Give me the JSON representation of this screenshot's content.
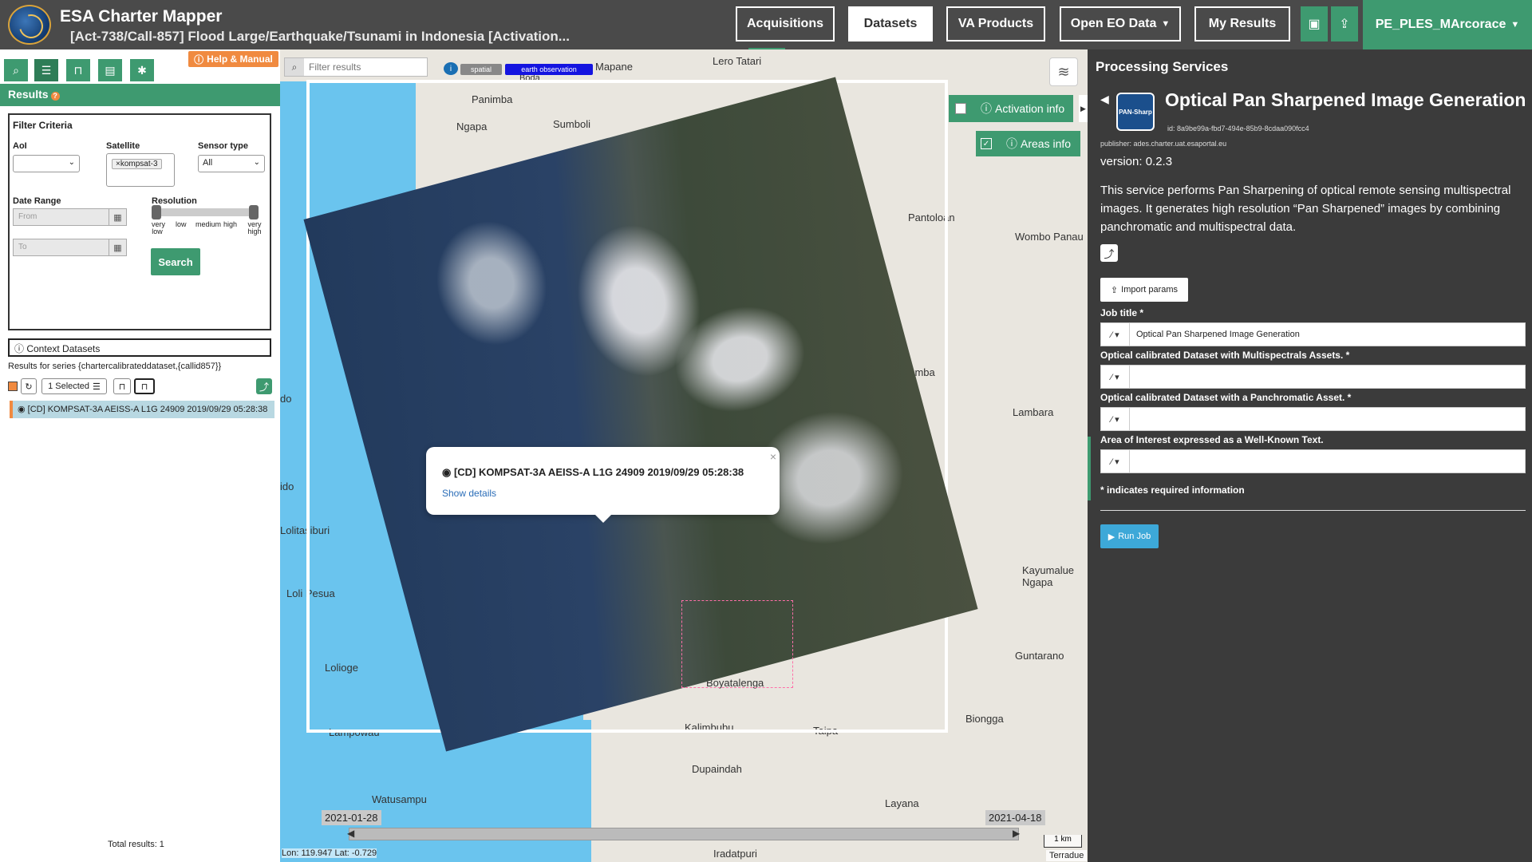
{
  "header": {
    "app_title": "ESA Charter Mapper",
    "activation": "[Act-738/Call-857] Flood Large/Earthquake/Tsunami in Indonesia [Activation...",
    "nav": [
      "Acquisitions",
      "Datasets",
      "VA Products",
      "Open EO Data",
      "My Results"
    ],
    "active_nav": "Datasets",
    "user": "PE_PLES_MArcorace"
  },
  "left": {
    "help": "Help & Manual",
    "results_title": "Results",
    "filter_title": "Filter Criteria",
    "aoi_label": "AoI",
    "satellite_label": "Satellite",
    "satellite_tag": "kompsat-3",
    "sensor_label": "Sensor type",
    "sensor_value": "All",
    "date_label": "Date Range",
    "from_placeholder": "From",
    "to_placeholder": "To",
    "resolution_label": "Resolution",
    "res_ticks": [
      "very low",
      "low",
      "medium",
      "high",
      "very high"
    ],
    "search": "Search",
    "context_title": "Context Datasets",
    "series_text": "Results for series {chartercalibrateddataset,{callid857}}",
    "selected": "1 Selected",
    "result_item": "[CD] KOMPSAT-3A AEISS-A L1G 24909 2019/09/29 05:28:38",
    "total": "Total results: 1"
  },
  "map": {
    "filter_placeholder": "Filter results",
    "chip_spatial": "spatial",
    "chip_eo": "earth observation",
    "activation_info": "Activation info",
    "areas_info": "Areas info",
    "labels": [
      "Mapane",
      "Lero Tatari",
      "Panimba",
      "Boda",
      "Sumboli",
      "Ngapa",
      "Pantoloan",
      "Wombo Panau",
      "Karumba",
      "Lambara",
      "do",
      "ido",
      "Lolitasiburi",
      "Loli Pesua",
      "Kayumalue Ngapa",
      "Lolioge",
      "Guntarano",
      "Boyatalenga",
      "Lampowau",
      "Kalimbubu",
      "Taipa",
      "Biongga",
      "Dupaindah",
      "Watusampu",
      "Layana",
      "Iradatpuri"
    ],
    "popup_title": "[CD] KOMPSAT-3A AEISS-A L1G 24909 2019/09/29 05:28:38",
    "popup_link": "Show details",
    "date_start": "2021-01-28",
    "date_end": "2021-04-18",
    "scale": "1 km",
    "coords": "Lon: 119.947 Lat: -0.729",
    "attribution": "Terradue"
  },
  "right": {
    "heading": "Processing Services",
    "service_title": "Optical Pan Sharpened Image Generation",
    "logo_text": "PAN-Sharp",
    "service_id": "id: 8a9be99a-fbd7-494e-85b9-8cdaa090fcc4",
    "publisher": "publisher: ades.charter.uat.esaportal.eu",
    "version": "version: 0.2.3",
    "description": "This service performs Pan Sharpening of optical remote sensing multispectral images. It generates high resolution “Pan Sharpened” images by combining panchromatic and multispectral data.",
    "import": "Import params",
    "job_title_label": "Job title *",
    "job_title_value": "Optical Pan Sharpened Image Generation",
    "ms_label": "Optical calibrated Dataset with Multispectrals Assets. *",
    "pan_label": "Optical calibrated Dataset with a Panchromatic Asset. *",
    "aoi_label": "Area of Interest expressed as a Well-Known Text.",
    "required_note": "* indicates required information",
    "run": "Run Job"
  },
  "colors": {
    "accent": "#3e9a70",
    "orange": "#f08a40",
    "header": "#4a4a4a",
    "panel": "#3b3b3b",
    "sea": "#6ac4ee"
  }
}
